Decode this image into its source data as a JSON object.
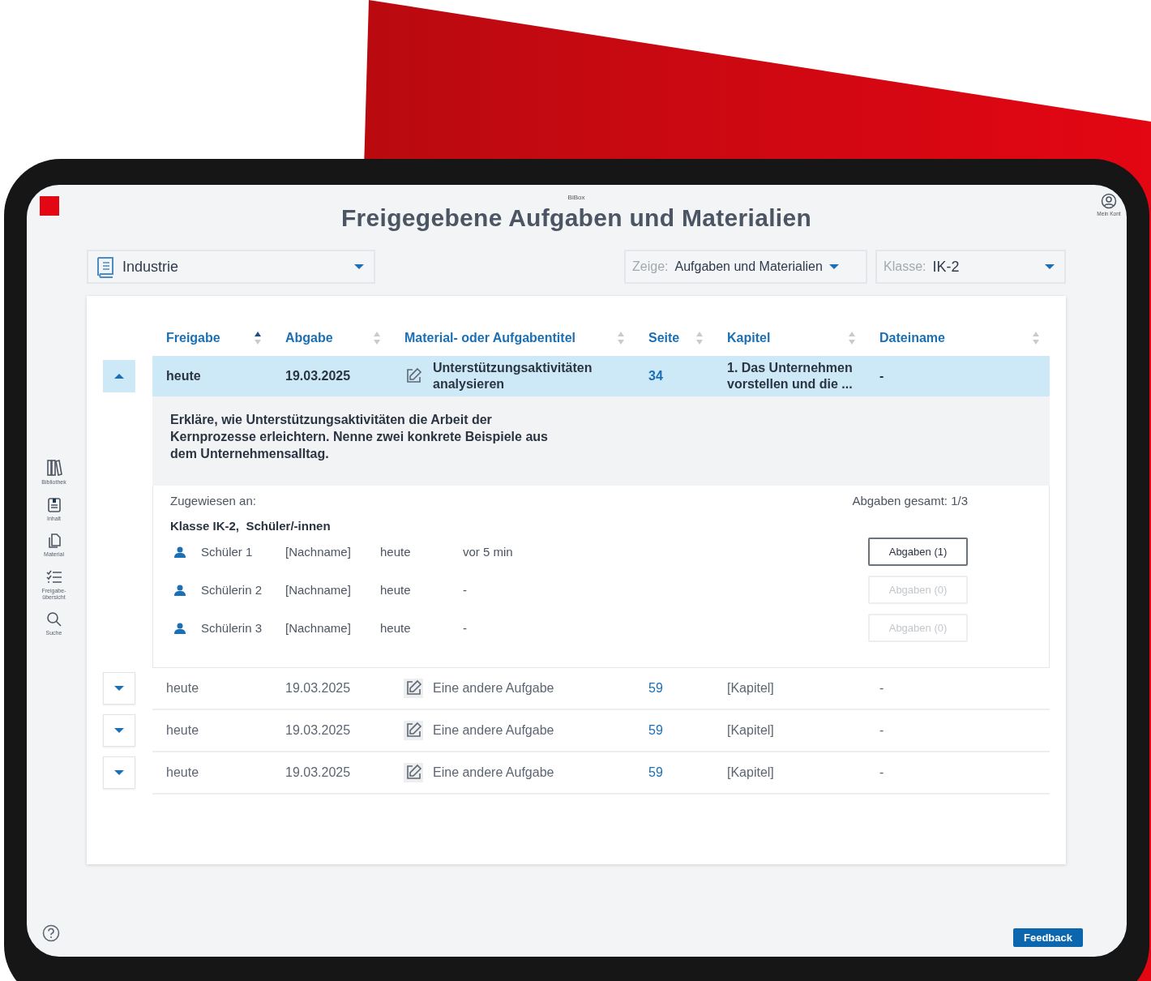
{
  "app": {
    "name": "BiBox",
    "title": "Freigegebene Aufgaben und Materialien",
    "account_label": "Mein Kont"
  },
  "sidebar": {
    "items": [
      {
        "kind": "library",
        "label": "Bibliothek"
      },
      {
        "kind": "content",
        "label": "Inhalt"
      },
      {
        "kind": "material",
        "label": "Material"
      },
      {
        "kind": "overview",
        "label": "Freigabe-übersicht"
      },
      {
        "kind": "search",
        "label": "Suche"
      }
    ]
  },
  "filters": {
    "book": {
      "value": "Industrie"
    },
    "show": {
      "label": "Zeige:",
      "value": "Aufgaben und Materialien"
    },
    "class": {
      "label": "Klasse:",
      "value": "IK-2"
    }
  },
  "table": {
    "columns": [
      {
        "label": "Freigabe",
        "sorted": true
      },
      {
        "label": "Abgabe",
        "sorted": false
      },
      {
        "label": "Material- oder Aufgabentitel",
        "sorted": false
      },
      {
        "label": "Seite",
        "sorted": false
      },
      {
        "label": "Kapitel",
        "sorted": false
      },
      {
        "label": "Dateiname",
        "sorted": false
      }
    ],
    "rows": [
      {
        "expanded": true,
        "selected": true,
        "freigabe": "heute",
        "abgabe": "19.03.2025",
        "title": "Unterstützungsaktivitäten analysieren",
        "seite": "34",
        "kapitel": "1. Das Unternehmen vorstellen und die ...",
        "dateiname": "-",
        "details": {
          "description": "Erkläre, wie Unterstützungsaktivitäten die Arbeit der Kernprozesse erleichtern. Nenne zwei konkrete Beispiele aus dem Unternehmensalltag.",
          "assigned_label": "Zugewiesen an:",
          "total": "Abgaben gesamt: 1/3",
          "group": "Klasse IK-2,  Schüler/-innen",
          "students": [
            {
              "name": "Schüler 1",
              "lastname": "[Nachname]",
              "date": "heute",
              "time": "vor 5 min",
              "button": {
                "label": "Abgaben (1)",
                "disabled": false
              }
            },
            {
              "name": "Schülerin 2",
              "lastname": "[Nachname]",
              "date": "heute",
              "time": "-",
              "button": {
                "label": "Abgaben (0)",
                "disabled": true
              }
            },
            {
              "name": "Schülerin 3",
              "lastname": "[Nachname]",
              "date": "heute",
              "time": "-",
              "button": {
                "label": "Abgaben (0)",
                "disabled": true
              }
            }
          ]
        }
      },
      {
        "expanded": false,
        "selected": false,
        "freigabe": "heute",
        "abgabe": "19.03.2025",
        "title": "Eine andere Aufgabe",
        "seite": "59",
        "kapitel": "[Kapitel]",
        "dateiname": "-"
      },
      {
        "expanded": false,
        "selected": false,
        "freigabe": "heute",
        "abgabe": "19.03.2025",
        "title": "Eine andere Aufgabe",
        "seite": "59",
        "kapitel": "[Kapitel]",
        "dateiname": "-"
      },
      {
        "expanded": false,
        "selected": false,
        "freigabe": "heute",
        "abgabe": "19.03.2025",
        "title": "Eine andere Aufgabe",
        "seite": "59",
        "kapitel": "[Kapitel]",
        "dateiname": "-"
      }
    ]
  },
  "feedback": {
    "label": "Feedback"
  }
}
